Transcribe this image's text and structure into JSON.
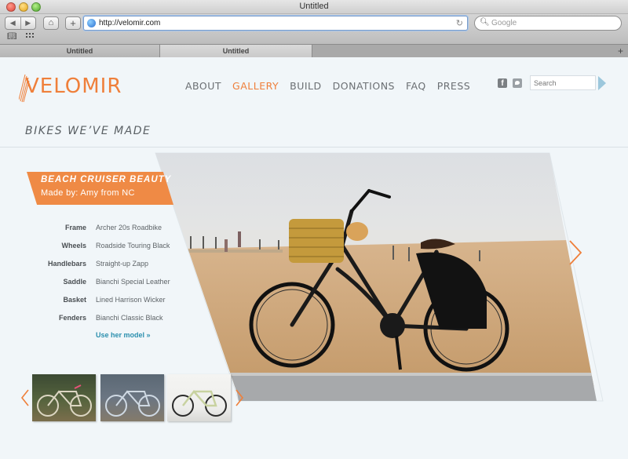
{
  "browser": {
    "window_title": "Untitled",
    "url": "http://velomir.com",
    "search_placeholder": "Google",
    "tabs": [
      {
        "label": "Untitled"
      },
      {
        "label": "Untitled"
      }
    ]
  },
  "site": {
    "logo_text": "VELOMIR",
    "nav": [
      {
        "label": "ABOUT"
      },
      {
        "label": "GALLERY"
      },
      {
        "label": "BUILD"
      },
      {
        "label": "DONATIONS"
      },
      {
        "label": "FAQ"
      },
      {
        "label": "PRESS"
      }
    ],
    "search_placeholder": "Search",
    "accent_color": "#ef7f3a",
    "link_color": "#2b8fae"
  },
  "gallery": {
    "section_title": "BIKES WE’VE MADE",
    "bike_name": "BEACH CRUISER BEAUTY",
    "maker": "Made by: Amy from NC",
    "specs": [
      {
        "label": "Frame",
        "value": "Archer 20s Roadbike"
      },
      {
        "label": "Wheels",
        "value": "Roadside Touring Black"
      },
      {
        "label": "Handlebars",
        "value": "Straight-up Zapp"
      },
      {
        "label": "Saddle",
        "value": "Bianchi Special Leather"
      },
      {
        "label": "Basket",
        "value": "Lined Harrison Wicker"
      },
      {
        "label": "Fenders",
        "value": "Bianchi Classic Black"
      }
    ],
    "cta": "Use her model »"
  }
}
